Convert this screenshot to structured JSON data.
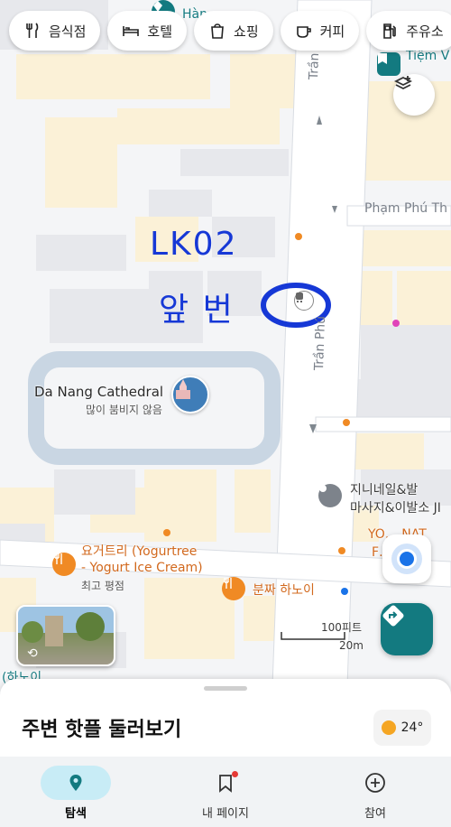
{
  "chips": [
    {
      "icon": "fork-knife-icon",
      "label": "음식점"
    },
    {
      "icon": "bed-icon",
      "label": "호텔"
    },
    {
      "icon": "shopping-bag-icon",
      "label": "쇼핑"
    },
    {
      "icon": "coffee-cup-icon",
      "label": "커피"
    },
    {
      "icon": "gas-station-icon",
      "label": "주유소"
    }
  ],
  "map": {
    "top_labels": {
      "line1": "Hàn",
      "partial_right": "Tiệm V"
    },
    "streets": {
      "tran_phu_top": "Trần Phú",
      "tran_phu_mid": "Trần Phú",
      "pham_phu_thu": "Phạm Phú Th"
    },
    "cathedral": {
      "name": "Da Nang Cathedral",
      "subtitle": "많이 붐비지 않음"
    },
    "place_right": {
      "line1": "지니네일&발",
      "line2": "마사지&이발소 JI"
    },
    "yogurt": {
      "line1": "요거트리 (Yogurtree",
      "line2": "- Yogurt Ice Cream)",
      "subtitle": "최고 평점"
    },
    "bun_cha": "분짜 하노이",
    "partial_bottom_left": "(하노이…",
    "partial_yo1": "YO… NAT",
    "partial_yo2": "F… YO",
    "scale": {
      "feet": "100피트",
      "meters": "20m"
    },
    "handwriting": {
      "line1": "LK02",
      "line2": "앞 번"
    }
  },
  "sheet": {
    "title": "주변 핫플 둘러보기",
    "temperature": "24°"
  },
  "nav": [
    {
      "icon": "map-pin-icon",
      "label": "탐색",
      "active": true
    },
    {
      "icon": "bookmark-icon",
      "label": "내 페이지",
      "active": false
    },
    {
      "icon": "plus-circle-icon",
      "label": "참여",
      "active": false
    }
  ],
  "colors": {
    "accent": "#1a73e8",
    "teal": "#137a80",
    "orange": "#f08a24",
    "ink": "#1638d6"
  }
}
